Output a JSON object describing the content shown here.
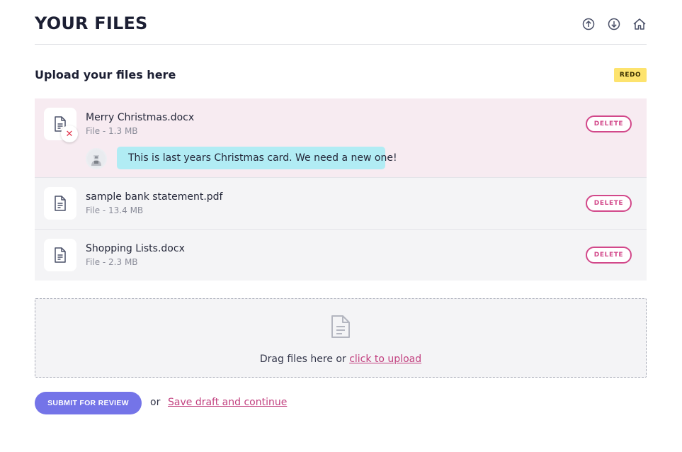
{
  "header": {
    "title": "YOUR FILES",
    "icons": [
      "arrow-up-circle-icon",
      "arrow-down-circle-icon",
      "home-icon"
    ]
  },
  "upload": {
    "title": "Upload your files here",
    "badge": "REDO"
  },
  "files": [
    {
      "name": "Merry Christmas.docx",
      "meta": "File - 1.3 MB",
      "status": "rejected",
      "delete_label": "DELETE",
      "comment": "This is last years Christmas card. We need a new one!"
    },
    {
      "name": "sample bank statement.pdf",
      "meta": "File - 13.4 MB",
      "delete_label": "DELETE"
    },
    {
      "name": "Shopping Lists.docx",
      "meta": "File - 2.3 MB",
      "delete_label": "DELETE"
    }
  ],
  "dropzone": {
    "text": "Drag files here or ",
    "link": "click to upload"
  },
  "footer": {
    "submit_label": "SUBMIT FOR REVIEW",
    "or": "or",
    "save_link": "Save draft and continue"
  },
  "colors": {
    "accent_pink": "#d2488a",
    "primary_button": "#7474e8",
    "badge_yellow": "#fde36e",
    "comment_bubble": "#b1ecf4",
    "flagged_row": "#f7ebf1"
  }
}
